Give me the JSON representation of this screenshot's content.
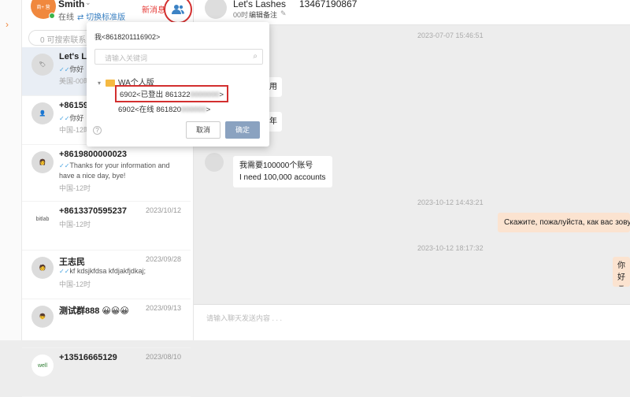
{
  "user": {
    "name": "Smith",
    "status": "在线",
    "switch_label": "切换标准版",
    "new_msg": "新消息",
    "logo_text": "商+ 营"
  },
  "search": {
    "placeholder": "0 可搜索联系人"
  },
  "contacts": [
    {
      "name": "Let's La",
      "date": "",
      "msg": "你好",
      "loc": "美国-00时",
      "active": true
    },
    {
      "name": "+86159",
      "date": "",
      "msg": "你好",
      "loc": "中国-12时"
    },
    {
      "name": "+8619800000023",
      "date": "",
      "msg": "Thanks for your information and",
      "msg2": "have a nice day, bye!",
      "loc": "中国-12时"
    },
    {
      "name": "+8613370595237",
      "date": "2023/10/12",
      "msg": "",
      "loc": "中国-12时",
      "avatar_text": "bitlab"
    },
    {
      "name": "王志民",
      "date": "2023/09/28",
      "msg": "kf kdsjkfdsa kfdjakfjdkaj;",
      "loc": "中国-12时"
    },
    {
      "name": "测试群888 😀😀😀",
      "date": "2023/09/13",
      "msg": "",
      "loc": ""
    },
    {
      "name": "+13516665129",
      "date": "2023/08/10",
      "msg": "",
      "loc": "",
      "avatar_text": "well"
    }
  ],
  "chat": {
    "name": "Let's Lashes",
    "phone": "13467190867",
    "sub": "00时",
    "edit_note": "编辑备注",
    "ts1": "2023-07-07 15:46:51",
    "bubble_partial1": "用",
    "bubble_partial2": "年",
    "bubble_cn": "我需要100000个账号",
    "bubble_en": "I need 100,000 accounts",
    "ts2": "2023-10-12 14:43:21",
    "bubble_ru": "Скажите, пожалуйста, как вас зову",
    "ts3": "2023-10-12 18:17:32",
    "bubble_out_partial": "你好",
    "bubble_out_partial2": "こん",
    "input_placeholder": "请输入聊天发送内容 . . ."
  },
  "popup": {
    "title": "我<8618201116902>",
    "search_placeholder": "请输入关键词",
    "group": "WA个人版",
    "item1": "6902<已登出 861322",
    "item1_blur": "0000000",
    "item1_end": ">",
    "item2": "6902<在线 861820",
    "item2_blur": "000000",
    "item2_end": ">",
    "cancel": "取消",
    "ok": "确定",
    "help": "?"
  }
}
